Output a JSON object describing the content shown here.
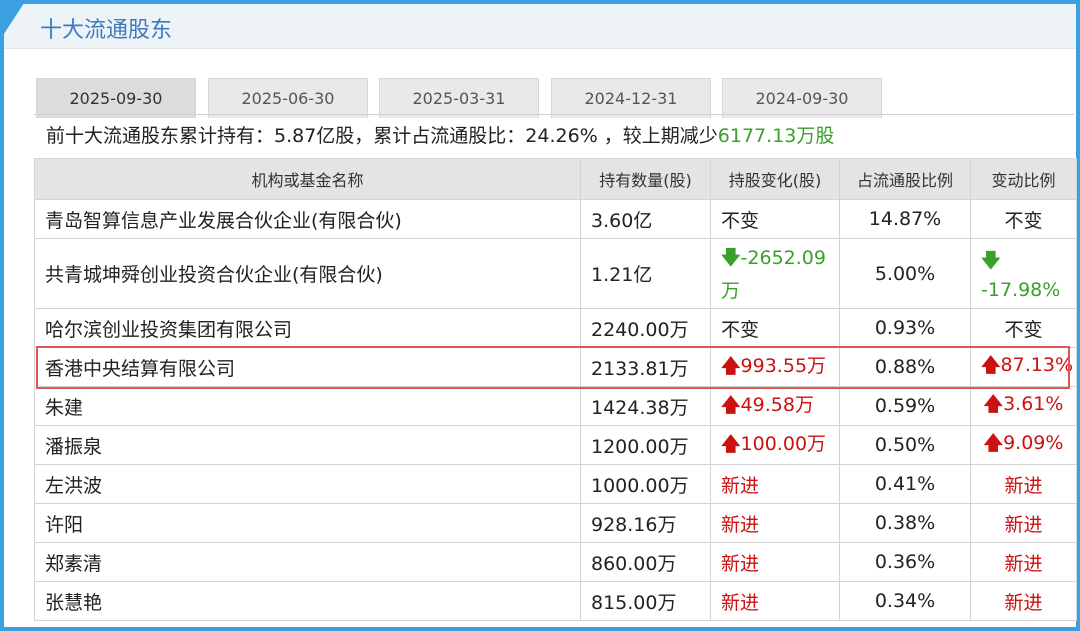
{
  "panel": {
    "title": "十大流通股东"
  },
  "tabs": [
    "2025-09-30",
    "2025-06-30",
    "2025-03-31",
    "2024-12-31",
    "2024-09-30"
  ],
  "active_tab": 0,
  "summary": {
    "prefix": "前十大流通股东累计持有：5.87亿股，累计占流通股比：24.26% ，较上期减少",
    "change": "6177.13万股"
  },
  "table": {
    "headers": [
      "机构或基金名称",
      "持有数量(股)",
      "持股变化(股)",
      "占流通股比例",
      "变动比例"
    ],
    "rows": [
      {
        "name": "青岛智算信息产业发展合伙企业(有限合伙)",
        "qty": "3.60亿",
        "change": "不变",
        "change_dir": "none",
        "ratio": "14.87%",
        "pct": "不变",
        "pct_dir": "none"
      },
      {
        "name": "共青城坤舜创业投资合伙企业(有限合伙)",
        "qty": "1.21亿",
        "change": "-2652.09万",
        "change_dir": "down",
        "ratio": "5.00%",
        "pct": "-17.98%",
        "pct_dir": "down"
      },
      {
        "name": "哈尔滨创业投资集团有限公司",
        "qty": "2240.00万",
        "change": "不变",
        "change_dir": "none",
        "ratio": "0.93%",
        "pct": "不变",
        "pct_dir": "none"
      },
      {
        "name": "香港中央结算有限公司",
        "qty": "2133.81万",
        "change": "993.55万",
        "change_dir": "up",
        "ratio": "0.88%",
        "pct": "87.13%",
        "pct_dir": "up"
      },
      {
        "name": "朱建",
        "qty": "1424.38万",
        "change": "49.58万",
        "change_dir": "up",
        "ratio": "0.59%",
        "pct": "3.61%",
        "pct_dir": "up"
      },
      {
        "name": "潘振泉",
        "qty": "1200.00万",
        "change": "100.00万",
        "change_dir": "up",
        "ratio": "0.50%",
        "pct": "9.09%",
        "pct_dir": "up"
      },
      {
        "name": "左洪波",
        "qty": "1000.00万",
        "change": "新进",
        "change_dir": "new",
        "ratio": "0.41%",
        "pct": "新进",
        "pct_dir": "new"
      },
      {
        "name": "许阳",
        "qty": "928.16万",
        "change": "新进",
        "change_dir": "new",
        "ratio": "0.38%",
        "pct": "新进",
        "pct_dir": "new"
      },
      {
        "name": "郑素清",
        "qty": "860.00万",
        "change": "新进",
        "change_dir": "new",
        "ratio": "0.36%",
        "pct": "新进",
        "pct_dir": "new"
      },
      {
        "name": "张慧艳",
        "qty": "815.00万",
        "change": "新进",
        "change_dir": "new",
        "ratio": "0.34%",
        "pct": "新进",
        "pct_dir": "new"
      }
    ]
  },
  "highlighted_row": 3,
  "colors": {
    "accent": "#3aa0e0",
    "up": "#cc1111",
    "down": "#3aa02a",
    "title": "#3a7cc0"
  }
}
